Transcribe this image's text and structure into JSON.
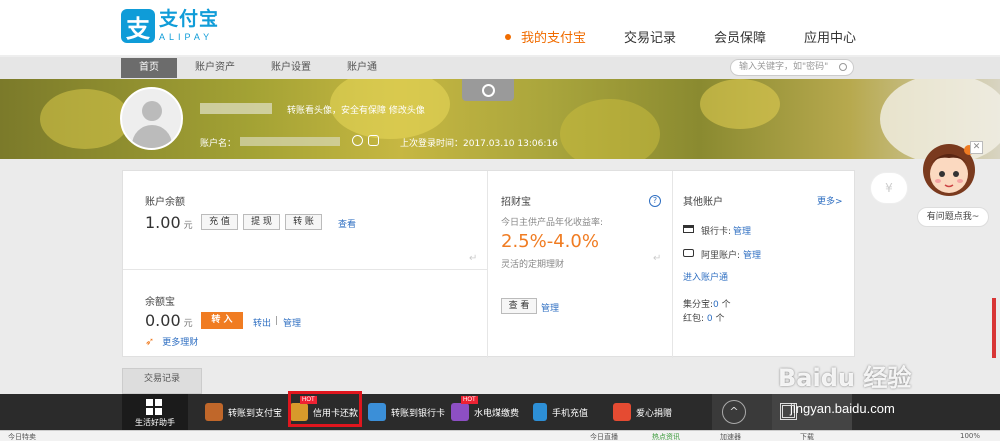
{
  "header": {
    "logo_icon_char": "支",
    "logo_cn": "支付宝",
    "logo_en": "ALIPAY",
    "nav": [
      "我的支付宝",
      "交易记录",
      "会员保障",
      "应用中心"
    ]
  },
  "subnav": {
    "items": [
      "首页",
      "账户资产",
      "账户设置",
      "账户通"
    ],
    "search_placeholder": "输入关键字，如\"密码\""
  },
  "profile": {
    "note": "转账看头像，安全有保障 修改头像",
    "account_label": "账户名：",
    "last_login": "上次登录时间：2017.03.10 13:06:16"
  },
  "balance": {
    "title": "账户余额",
    "amount": "1.00",
    "unit": "元",
    "buttons": [
      "充 值",
      "提 现",
      "转 账"
    ],
    "view_link": "查看"
  },
  "yuebao": {
    "title": "余额宝",
    "amount": "0.00",
    "unit": "元",
    "transfer_in": "转 入",
    "transfer_out": "转出",
    "separator": "|",
    "manage": "管理",
    "more": "更多理财"
  },
  "zhaocai": {
    "title": "招财宝",
    "help": "?",
    "desc": "今日主供产品年化收益率:",
    "rate": "2.5%-4.0%",
    "sub": "灵活的定期理财",
    "view_btn": "查 看",
    "manage": "管理"
  },
  "other_accounts": {
    "title": "其他账户",
    "more": "更多>",
    "bank_label": "银行卡:",
    "bank_manage": "管理",
    "ali_label": "阿里账户:",
    "ali_manage": "管理",
    "enter": "进入账户通",
    "jifen_label": "集分宝:",
    "jifen_value": "0",
    "jifen_unit": "个",
    "hongbao_label": "红包:",
    "hongbao_value": "0",
    "hongbao_unit": "个"
  },
  "float": {
    "yen": "¥",
    "ask": "有问题点我~",
    "close": "✕"
  },
  "tab_trade": "交易记录",
  "toolbar": {
    "helper": "生活好助手",
    "tools": [
      {
        "label": "转账到支付宝",
        "color": "#c0672a",
        "hot": false
      },
      {
        "label": "信用卡还款",
        "color": "#d79a2b",
        "hot": true
      },
      {
        "label": "转账到银行卡",
        "color": "#3b8fd8",
        "hot": false
      },
      {
        "label": "水电煤缴费",
        "color": "#8d4fc4",
        "hot": true
      },
      {
        "label": "手机充值",
        "color": "#2d8fd6",
        "hot": false
      },
      {
        "label": "爱心捐赠",
        "color": "#e54b32",
        "hot": false
      }
    ],
    "hot_label": "HOT",
    "up_arrow": "^"
  },
  "watermark": {
    "brand": "Baidu 经验",
    "domain": "jingyan.baidu.com"
  },
  "statusbar": [
    "今日特卖",
    "今日直播",
    "热点资讯",
    "加速器",
    "下载",
    "100%"
  ]
}
